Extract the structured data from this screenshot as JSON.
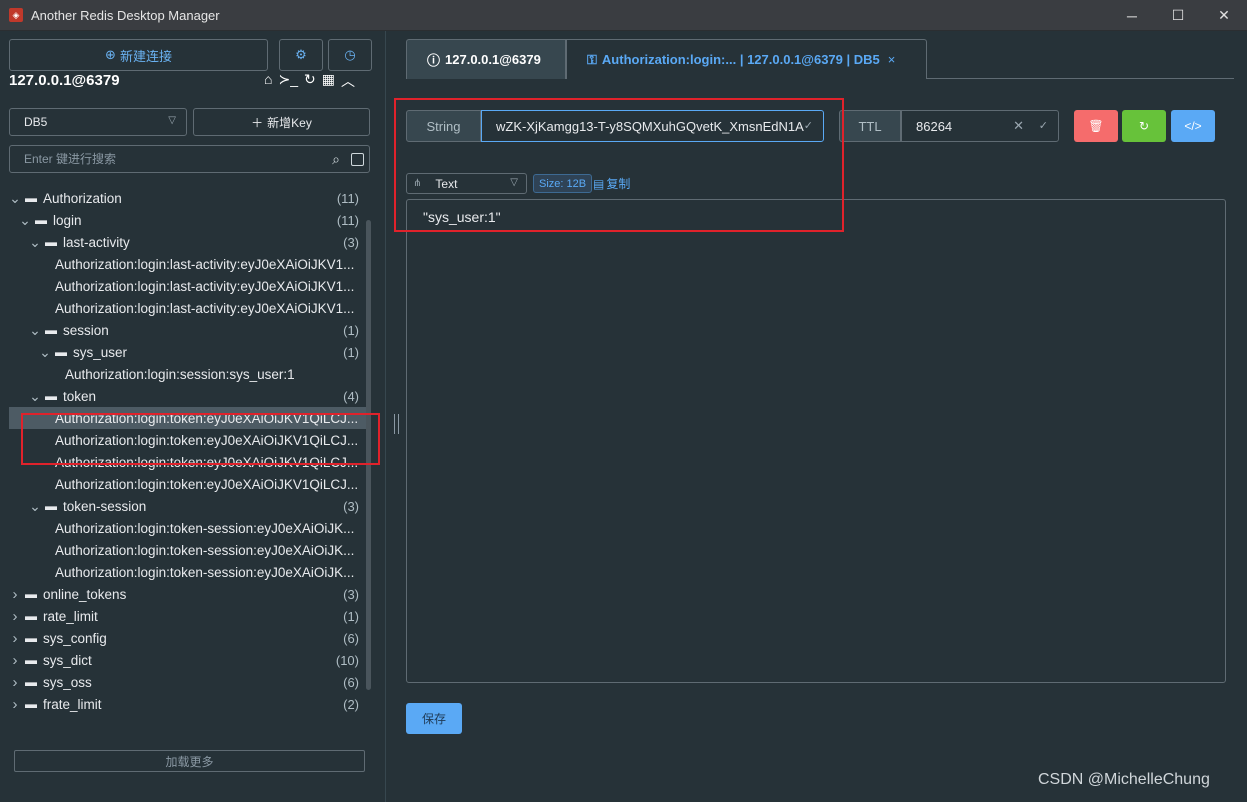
{
  "window": {
    "title": "Another Redis Desktop Manager"
  },
  "left": {
    "new_connection": "新建连接",
    "connection_name": "127.0.0.1@6379",
    "db_select": "DB5",
    "add_key": "新增Key",
    "search_placeholder": "Enter 键进行搜索",
    "load_more": "加载更多",
    "tree": [
      {
        "label": "Authorization",
        "count": "(11)",
        "level": 0,
        "type": "folder-open"
      },
      {
        "label": "login",
        "count": "(11)",
        "level": 1,
        "type": "folder-open"
      },
      {
        "label": "last-activity",
        "count": "(3)",
        "level": 2,
        "type": "folder-open"
      },
      {
        "label": "Authorization:login:last-activity:eyJ0eXAiOiJKV1...",
        "level": 3,
        "type": "leaf"
      },
      {
        "label": "Authorization:login:last-activity:eyJ0eXAiOiJKV1...",
        "level": 3,
        "type": "leaf"
      },
      {
        "label": "Authorization:login:last-activity:eyJ0eXAiOiJKV1...",
        "level": 3,
        "type": "leaf"
      },
      {
        "label": "session",
        "count": "(1)",
        "level": 2,
        "type": "folder-open"
      },
      {
        "label": "sys_user",
        "count": "(1)",
        "level": 3,
        "type": "folder-open"
      },
      {
        "label": "Authorization:login:session:sys_user:1",
        "level": 4,
        "type": "leaf"
      },
      {
        "label": "token",
        "count": "(4)",
        "level": 2,
        "type": "folder-open"
      },
      {
        "label": "Authorization:login:token:eyJ0eXAiOiJKV1QiLCJ...",
        "level": 3,
        "type": "leaf",
        "selected": true
      },
      {
        "label": "Authorization:login:token:eyJ0eXAiOiJKV1QiLCJ...",
        "level": 3,
        "type": "leaf"
      },
      {
        "label": "Authorization:login:token:eyJ0eXAiOiJKV1QiLCJ...",
        "level": 3,
        "type": "leaf"
      },
      {
        "label": "Authorization:login:token:eyJ0eXAiOiJKV1QiLCJ...",
        "level": 3,
        "type": "leaf"
      },
      {
        "label": "token-session",
        "count": "(3)",
        "level": 2,
        "type": "folder-open"
      },
      {
        "label": "Authorization:login:token-session:eyJ0eXAiOiJK...",
        "level": 3,
        "type": "leaf"
      },
      {
        "label": "Authorization:login:token-session:eyJ0eXAiOiJK...",
        "level": 3,
        "type": "leaf"
      },
      {
        "label": "Authorization:login:token-session:eyJ0eXAiOiJK...",
        "level": 3,
        "type": "leaf"
      },
      {
        "label": "online_tokens",
        "count": "(3)",
        "level": 0,
        "type": "folder"
      },
      {
        "label": "rate_limit",
        "count": "(1)",
        "level": 0,
        "type": "folder"
      },
      {
        "label": "sys_config",
        "count": "(6)",
        "level": 0,
        "type": "folder"
      },
      {
        "label": "sys_dict",
        "count": "(10)",
        "level": 0,
        "type": "folder"
      },
      {
        "label": "sys_oss",
        "count": "(6)",
        "level": 0,
        "type": "folder"
      },
      {
        "label": "frate_limit",
        "count": "(2)",
        "level": 0,
        "type": "folder"
      }
    ]
  },
  "tabs": [
    {
      "label": "127.0.0.1@6379",
      "icon": "info-icon"
    },
    {
      "label": "Authorization:login:... | 127.0.0.1@6379 | DB5",
      "icon": "key-icon",
      "close": "×"
    }
  ],
  "key": {
    "type": "String",
    "name": "wZK-XjKamgg13-T-y8SQMXuhGQvetK_XmsnEdN1A",
    "ttl_label": "TTL",
    "ttl": "86264"
  },
  "value": {
    "format": "Text",
    "size": "Size: 12B",
    "copy": "复制",
    "content": "\"sys_user:1\"",
    "save": "保存"
  },
  "colors": {
    "delete": "#f56c6c",
    "refresh": "#67c23a",
    "dump": "#5aa9f5",
    "highlight": "#e0222b"
  },
  "watermark": "CSDN @MichelleChung"
}
